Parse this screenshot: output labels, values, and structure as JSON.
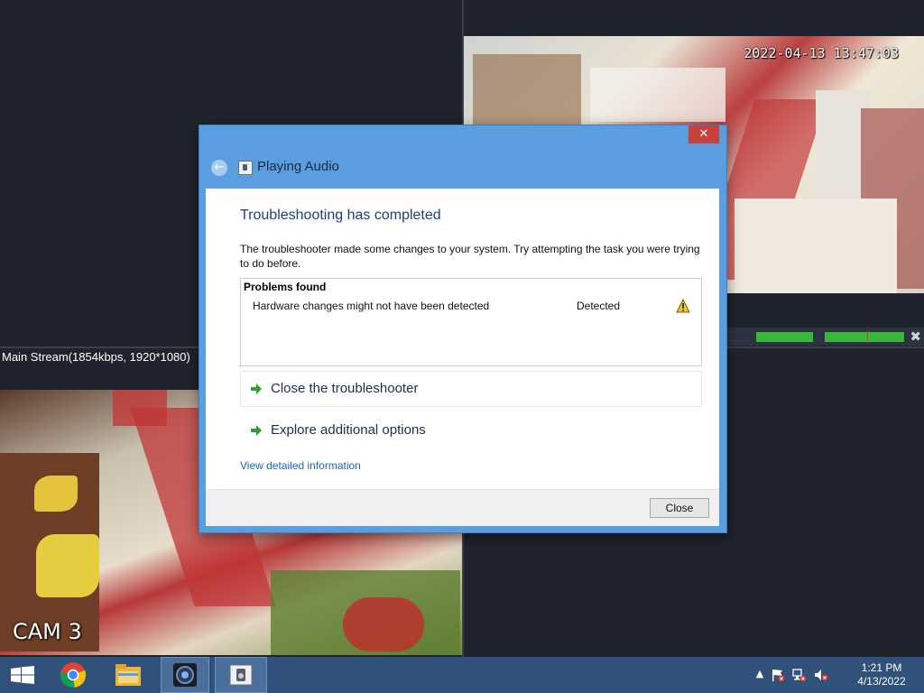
{
  "cameras": {
    "top_right": {
      "timestamp": "2022-04-13 13:47:03"
    },
    "bottom_left": {
      "label": "CAM 3",
      "stream_info": "Main Stream(1854kbps, 1920*1080)"
    }
  },
  "playback_bar": {
    "close_icon": "close-icon",
    "segment_color": "#37b83a",
    "marker_color": "#d23b3b"
  },
  "dialog": {
    "close_glyph": "✕",
    "back_icon": "back-arrow-icon",
    "title": "Playing Audio",
    "heading": "Troubleshooting has completed",
    "description": "The troubleshooter made some changes to your system. Try attempting the task you were trying to do before.",
    "problems": {
      "title": "Problems found",
      "rows": [
        {
          "description": "Hardware changes might not have been detected",
          "status": "Detected",
          "icon": "warning-icon"
        }
      ]
    },
    "options": [
      {
        "label": "Close the troubleshooter",
        "icon": "green-arrow-icon"
      },
      {
        "label": "Explore additional options",
        "icon": "green-arrow-icon"
      }
    ],
    "detail_link": "View detailed information",
    "close_button": "Close",
    "accent_color": "#5a9ee0"
  },
  "taskbar": {
    "items": [
      "start-icon",
      "chrome-icon",
      "file-explorer-icon",
      "camera-app-icon",
      "troubleshooter-icon"
    ],
    "tray_icons": [
      "show-hidden-icons",
      "action-center-flag-icon",
      "network-icon",
      "volume-muted-icon"
    ],
    "tray_arrow": "▲",
    "time": "1:21 PM",
    "date": "4/13/2022"
  }
}
